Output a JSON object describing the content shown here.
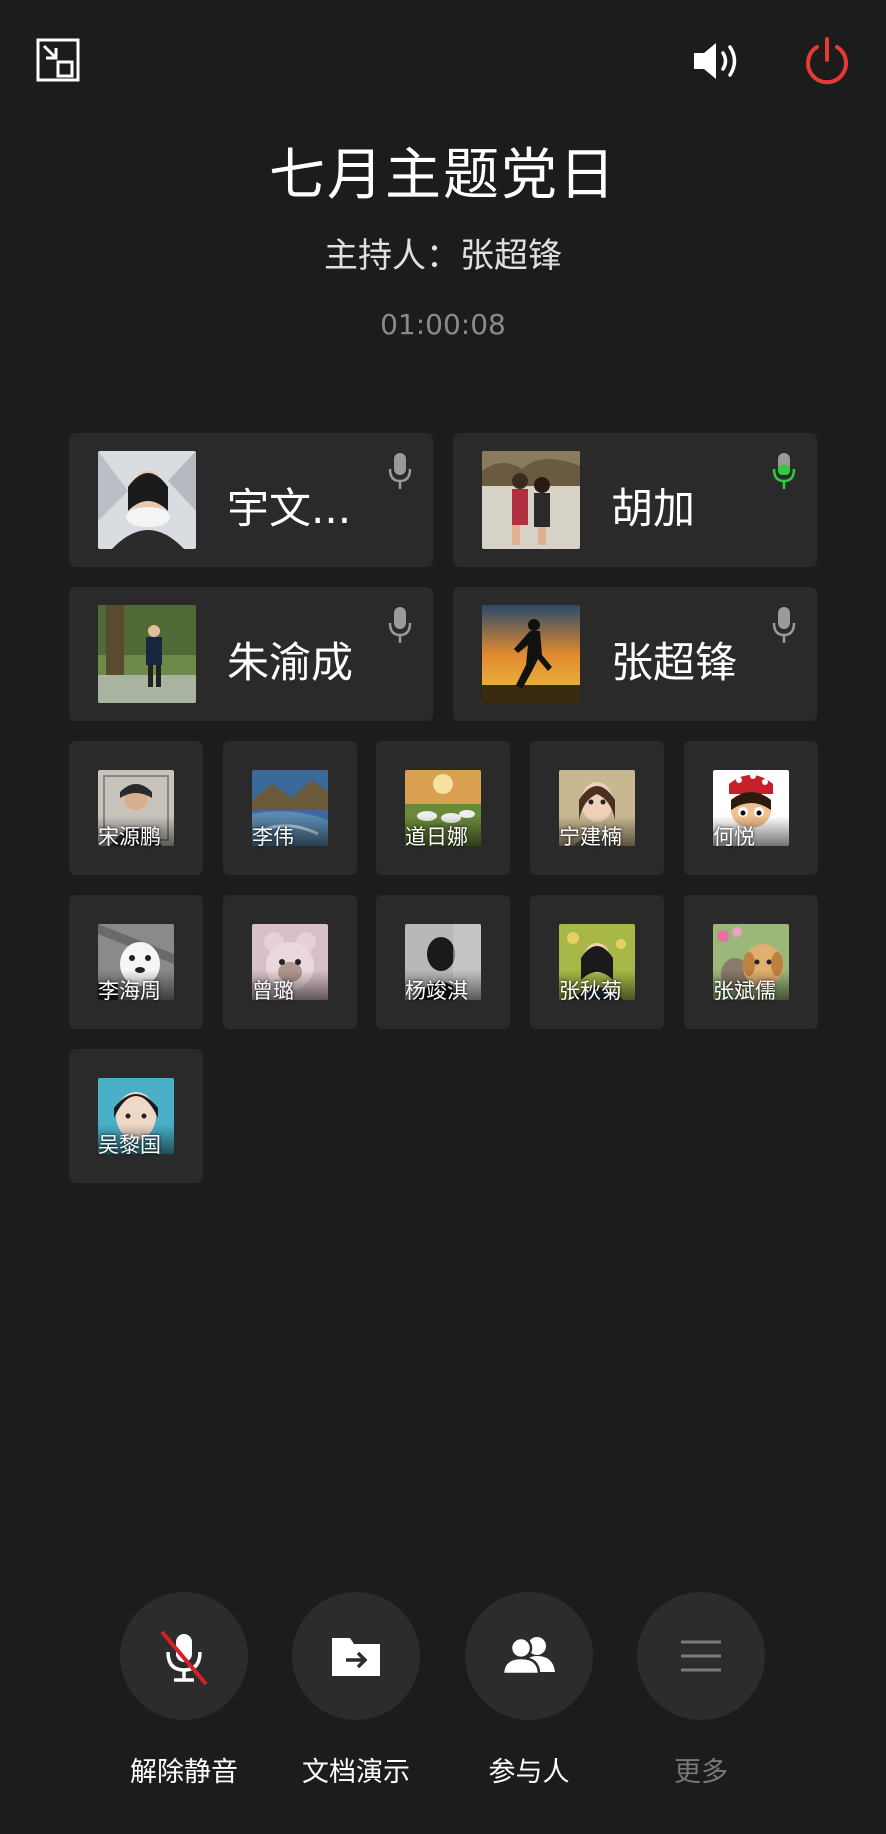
{
  "header": {
    "title": "七月主题党日",
    "host": "主持人：张超锋",
    "timer": "01:00:08"
  },
  "icons": {
    "minimize": "exit-fullscreen-icon",
    "speaker": "speaker-volume-icon",
    "power": "power-icon"
  },
  "colors": {
    "background": "#1c1c1c",
    "card": "#2a2a2a",
    "power_red": "#e53935",
    "active_mic_green": "#2ecc40",
    "muted_mic_gray": "#9a9a9a"
  },
  "featured": [
    {
      "name": "宇文...",
      "mic": "idle"
    },
    {
      "name": "胡加",
      "mic": "active"
    },
    {
      "name": "朱渝成",
      "mic": "idle"
    },
    {
      "name": "张超锋",
      "mic": "idle"
    }
  ],
  "participants": [
    {
      "name": "宋源鹏"
    },
    {
      "name": "李伟"
    },
    {
      "name": "道日娜"
    },
    {
      "name": "宁建楠"
    },
    {
      "name": "何悦"
    },
    {
      "name": "李海周"
    },
    {
      "name": "曾璐"
    },
    {
      "name": "杨竣淇"
    },
    {
      "name": "张秋菊"
    },
    {
      "name": "张斌儒"
    },
    {
      "name": "吴黎国"
    }
  ],
  "actions": [
    {
      "label": "解除静音",
      "icon": "mic-muted-icon"
    },
    {
      "label": "文档演示",
      "icon": "folder-share-icon"
    },
    {
      "label": "参与人",
      "icon": "people-icon"
    },
    {
      "label": "更多",
      "icon": "menu-icon",
      "disabled": true
    }
  ]
}
